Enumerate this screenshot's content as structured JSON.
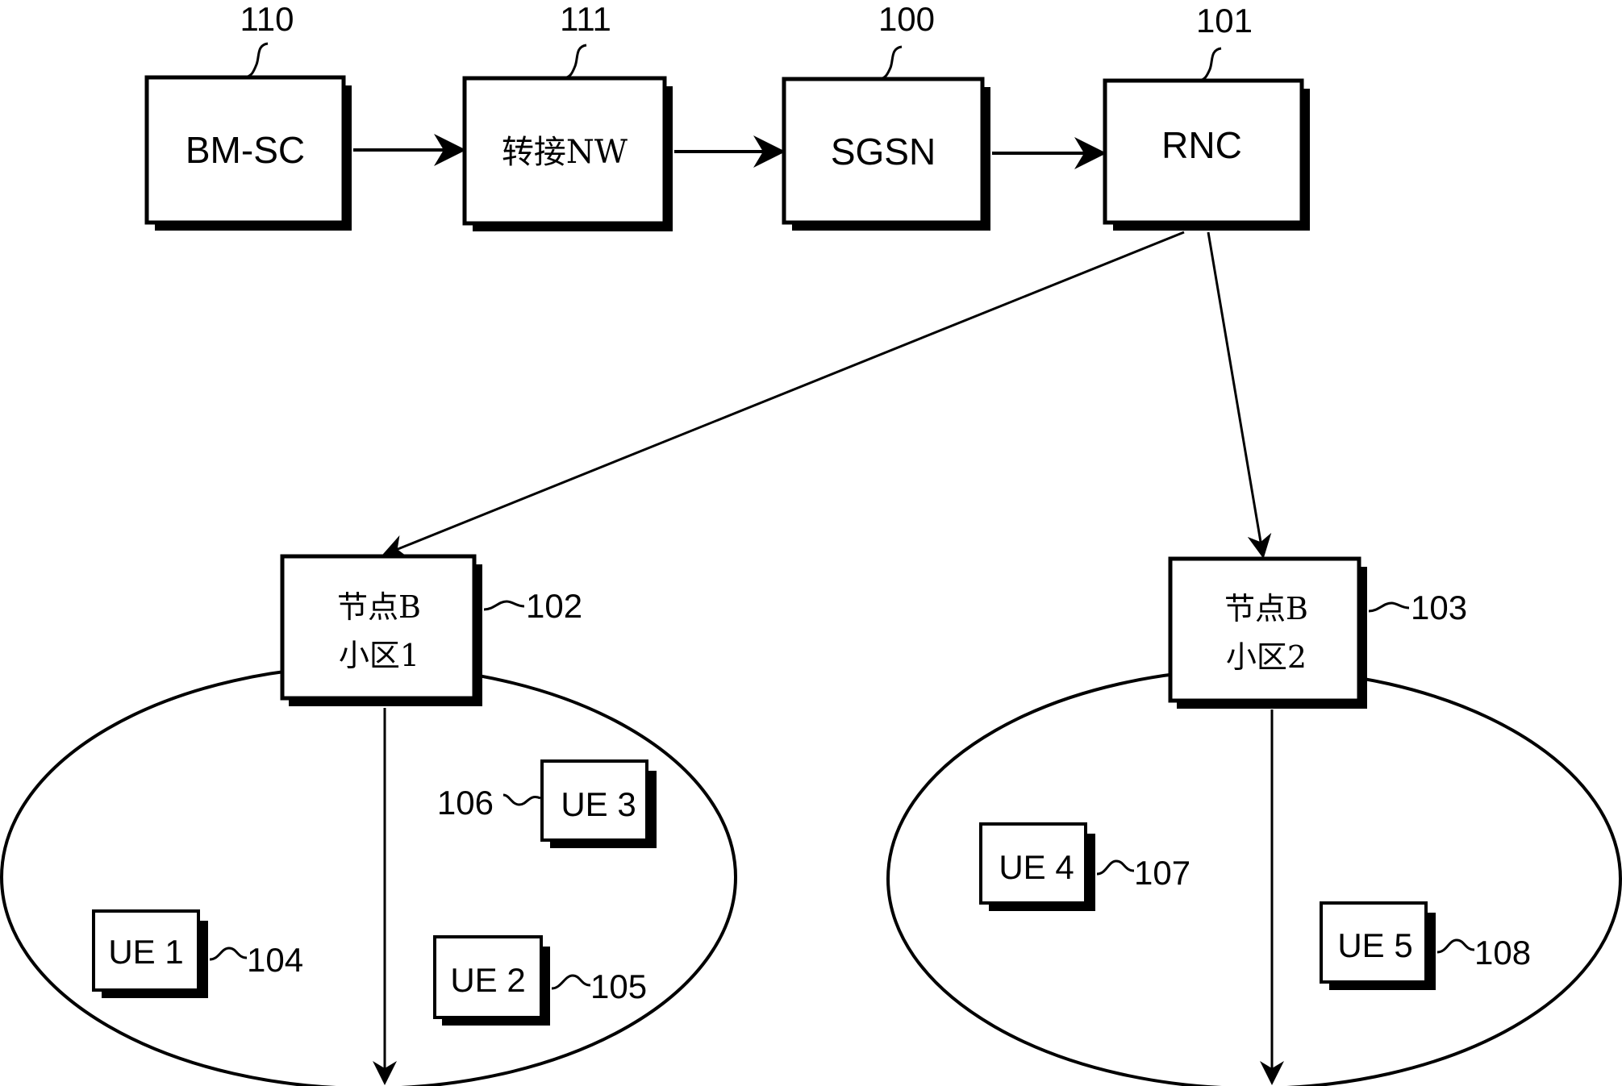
{
  "figure": {
    "type": "network block diagram",
    "top_row": [
      {
        "id": "110",
        "label": "BM-SC"
      },
      {
        "id": "111",
        "label": "转接NW"
      },
      {
        "id": "100",
        "label": "SGSN"
      },
      {
        "id": "101",
        "label": "RNC"
      }
    ],
    "node_b": [
      {
        "id": "102",
        "line1": "节点B",
        "line2": "小区1"
      },
      {
        "id": "103",
        "line1": "节点B",
        "line2": "小区2"
      }
    ],
    "user_equipment": [
      {
        "id": "104",
        "label": "UE 1",
        "cell": "小区1"
      },
      {
        "id": "105",
        "label": "UE 2",
        "cell": "小区1"
      },
      {
        "id": "106",
        "label": "UE 3",
        "cell": "小区1"
      },
      {
        "id": "107",
        "label": "UE 4",
        "cell": "小区2"
      },
      {
        "id": "108",
        "label": "UE 5",
        "cell": "小区2"
      }
    ],
    "connections": [
      {
        "from": "BM-SC",
        "to": "转接NW"
      },
      {
        "from": "转接NW",
        "to": "SGSN"
      },
      {
        "from": "SGSN",
        "to": "RNC"
      },
      {
        "from": "RNC",
        "to": "节点B 小区1"
      },
      {
        "from": "RNC",
        "to": "节点B 小区2"
      },
      {
        "from": "节点B 小区1",
        "to": "cell 1 coverage"
      },
      {
        "from": "节点B 小区2",
        "to": "cell 2 coverage"
      }
    ]
  }
}
